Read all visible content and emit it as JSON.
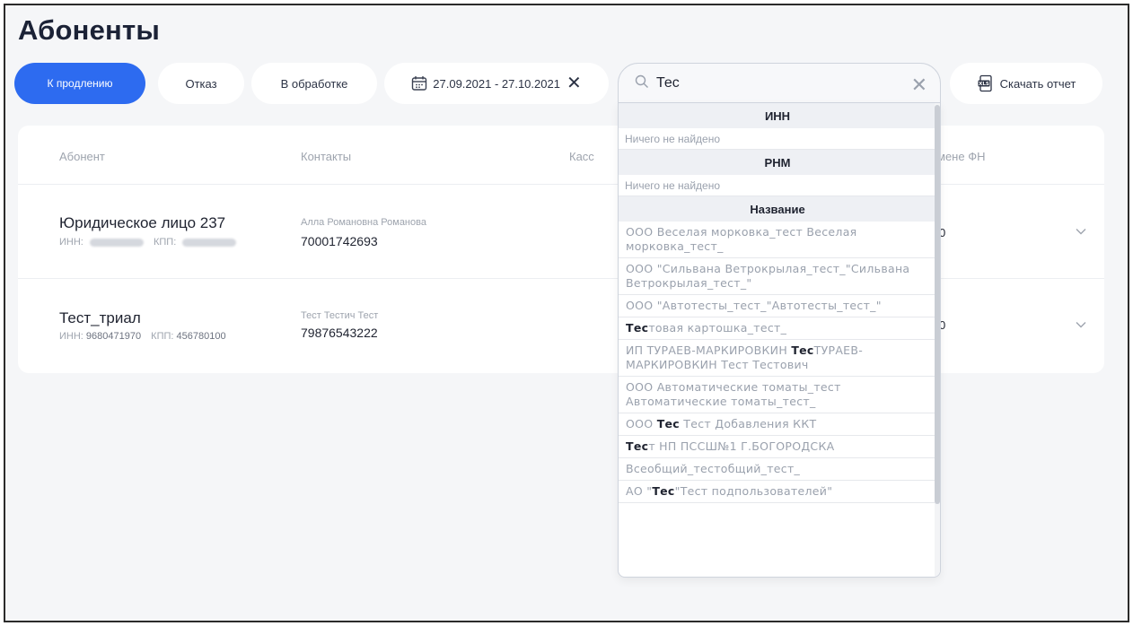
{
  "page": {
    "title": "Абоненты"
  },
  "filters": {
    "tab_renewal": "К продлению",
    "tab_refused": "Отказ",
    "tab_processing": "В обработке",
    "date_range": "27.09.2021 - 27.10.2021",
    "download_report": "Скачать отчет"
  },
  "search": {
    "query": "Тес"
  },
  "table": {
    "headers": {
      "subscriber": "Абонент",
      "contacts": "Контакты",
      "kass": "Касс",
      "fn": "мене ФН"
    },
    "rows": [
      {
        "name": "Юридическое лицо 237",
        "inn_label": "ИНН:",
        "kpp_label": "КПП:",
        "contact_name": "Алла Романовна Романова",
        "phone": "70001742693",
        "count": "0"
      },
      {
        "name": "Тест_триал",
        "inn_label": "ИНН:",
        "inn": "9680471970",
        "kpp_label": "КПП:",
        "kpp": "456780100",
        "contact_name": "Тест Тестич Тест",
        "phone": "79876543222",
        "count": "0"
      }
    ]
  },
  "dropdown": {
    "inn_header": "ИНН",
    "inn_empty": "Ничего не найдено",
    "rnm_header": "РНМ",
    "rnm_empty": "Ничего не найдено",
    "name_header": "Название",
    "items": [
      {
        "pre": "ООО Веселая морковка_тест Веселая морковка_тест_",
        "hl": "",
        "post": ""
      },
      {
        "pre": "ООО \"Сильвана Ветрокрылая_тест_\"Сильвана Ветрокрылая_тест_\"",
        "hl": "",
        "post": ""
      },
      {
        "pre": "ООО \"Автотесты_тест_\"Автотесты_тест_\"",
        "hl": "",
        "post": ""
      },
      {
        "pre": "",
        "hl": "Тес",
        "post": "товая картошка_тест_"
      },
      {
        "pre": "ИП ТУРАЕВ-МАРКИРОВКИН ",
        "hl": "Тес",
        "post": "ТУРАЕВ-МАРКИРОВКИН Тест Тестович"
      },
      {
        "pre": "ООО Автоматические томаты_тест Автоматические томаты_тест_",
        "hl": "",
        "post": ""
      },
      {
        "pre": "ООО ",
        "hl": "Тес",
        "post": " Тест Добавления ККТ"
      },
      {
        "pre": "",
        "hl": "Тес",
        "post": "т НП ПССШ№1 Г.БОГОРОДСКА"
      },
      {
        "pre": "Всеобщий_тестобщий_тест_",
        "hl": "",
        "post": ""
      },
      {
        "pre": "АО \"",
        "hl": "Тес",
        "post": "\"Тест подпользователей\""
      }
    ]
  }
}
